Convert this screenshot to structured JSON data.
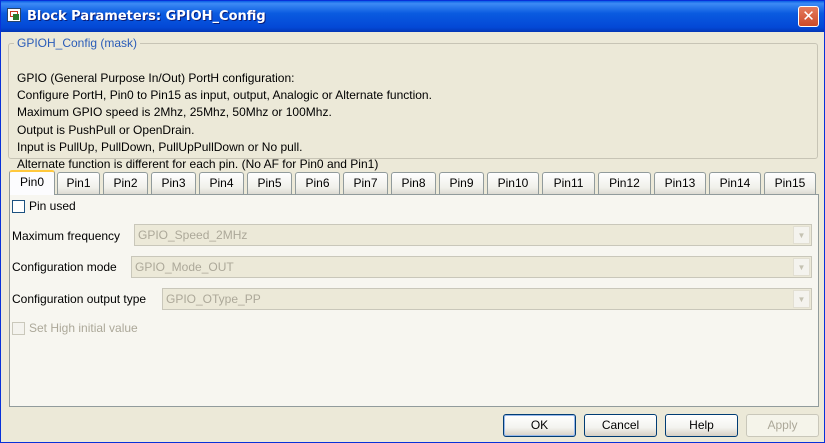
{
  "window": {
    "title": "Block Parameters: GPIOH_Config",
    "close_glyph": "✕"
  },
  "mask": {
    "legend": "GPIOH_Config (mask)",
    "description": [
      "GPIO (General Purpose In/Out) PortH configuration:",
      "Configure PortH, Pin0 to Pin15 as input, output, Analogic or Alternate function.",
      "Maximum GPIO speed is 2Mhz, 25Mhz, 50Mhz or 100Mhz.",
      "Output is PushPull or OpenDrain.",
      "Input is PullUp, PullDown, PullUpPullDown or No pull.",
      "Alternate function is different for each pin. (No AF for Pin0 and Pin1)"
    ]
  },
  "tabs": [
    "Pin0",
    "Pin1",
    "Pin2",
    "Pin3",
    "Pin4",
    "Pin5",
    "Pin6",
    "Pin7",
    "Pin8",
    "Pin9",
    "Pin10",
    "Pin11",
    "Pin12",
    "Pin13",
    "Pin14",
    "Pin15"
  ],
  "active_tab": "Pin0",
  "pin": {
    "pin_used_label": "Pin used",
    "pin_used_checked": false,
    "max_freq_label": "Maximum frequency",
    "max_freq_value": "GPIO_Speed_2MHz",
    "config_mode_label": "Configuration mode",
    "config_mode_value": "GPIO_Mode_OUT",
    "output_type_label": "Configuration output type",
    "output_type_value": "GPIO_OType_PP",
    "set_high_label": "Set High initial value",
    "set_high_checked": false
  },
  "buttons": {
    "ok": "OK",
    "cancel": "Cancel",
    "help": "Help",
    "apply": "Apply"
  }
}
